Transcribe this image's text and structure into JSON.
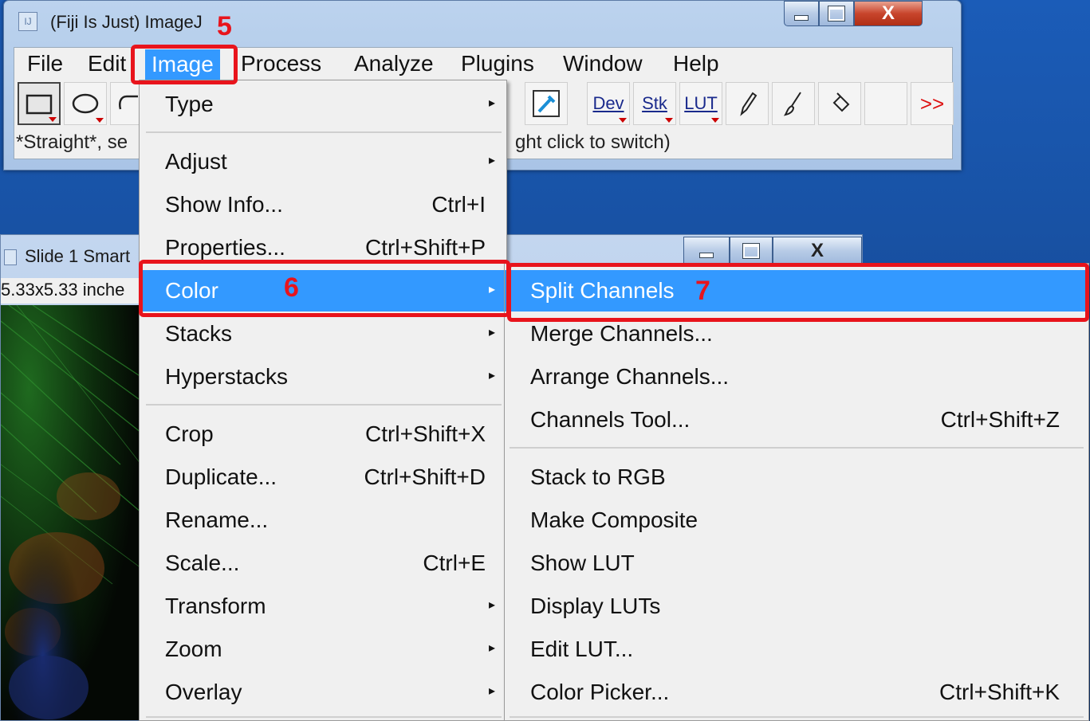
{
  "main_window": {
    "title": "(Fiji Is Just) ImageJ",
    "title_icon": "IJ",
    "controls": {
      "minimize": "minimize-icon",
      "maximize": "maximize-icon",
      "close": "X"
    }
  },
  "menubar": {
    "items": [
      "File",
      "Edit",
      "Image",
      "Process",
      "Analyze",
      "Plugins",
      "Window",
      "Help"
    ],
    "active": "Image"
  },
  "toolbar": {
    "tools": [
      {
        "name": "rectangle-icon"
      },
      {
        "name": "oval-icon"
      },
      {
        "name": "polygon-icon"
      },
      {
        "name": "color-picker-icon"
      },
      {
        "name": "dev-tool",
        "label": "Dev"
      },
      {
        "name": "stk-tool",
        "label": "Stk"
      },
      {
        "name": "lut-tool",
        "label": "LUT"
      },
      {
        "name": "pencil-icon"
      },
      {
        "name": "brush-icon"
      },
      {
        "name": "flood-fill-icon"
      },
      {
        "name": "blank-tool"
      },
      {
        "name": "more-tools",
        "label": ">>"
      }
    ]
  },
  "status": {
    "left": "*Straight*, se",
    "right": "ght click to switch)"
  },
  "image_window": {
    "title": "Slide 1 Smart",
    "info": "5.33x5.33 inche"
  },
  "image_menu": {
    "items": [
      {
        "label": "Type",
        "submenu": true
      },
      {
        "label": "Adjust",
        "submenu": true
      },
      {
        "label": "Show Info...",
        "shortcut": "Ctrl+I"
      },
      {
        "label": "Properties...",
        "shortcut": "Ctrl+Shift+P"
      },
      {
        "label": "Color",
        "submenu": true,
        "highlighted": true
      },
      {
        "label": "Stacks",
        "submenu": true
      },
      {
        "label": "Hyperstacks",
        "submenu": true
      },
      {
        "label": "Crop",
        "shortcut": "Ctrl+Shift+X"
      },
      {
        "label": "Duplicate...",
        "shortcut": "Ctrl+Shift+D"
      },
      {
        "label": "Rename..."
      },
      {
        "label": "Scale...",
        "shortcut": "Ctrl+E"
      },
      {
        "label": "Transform",
        "submenu": true
      },
      {
        "label": "Zoom",
        "submenu": true
      },
      {
        "label": "Overlay",
        "submenu": true
      }
    ],
    "arrow": "▸"
  },
  "color_menu": {
    "items": [
      {
        "label": "Split Channels",
        "highlighted": true
      },
      {
        "label": "Merge Channels..."
      },
      {
        "label": "Arrange Channels..."
      },
      {
        "label": "Channels Tool...",
        "shortcut": "Ctrl+Shift+Z"
      },
      {
        "label": "Stack to RGB"
      },
      {
        "label": "Make Composite"
      },
      {
        "label": "Show LUT"
      },
      {
        "label": "Display LUTs"
      },
      {
        "label": "Edit LUT..."
      },
      {
        "label": "Color Picker...",
        "shortcut": "Ctrl+Shift+K"
      }
    ]
  },
  "annotations": {
    "step5": "5",
    "step6": "6",
    "step7": "7",
    "color": "#e8141c"
  },
  "colors": {
    "highlight": "#3399ff",
    "menu_bg": "#f0f0f0"
  }
}
